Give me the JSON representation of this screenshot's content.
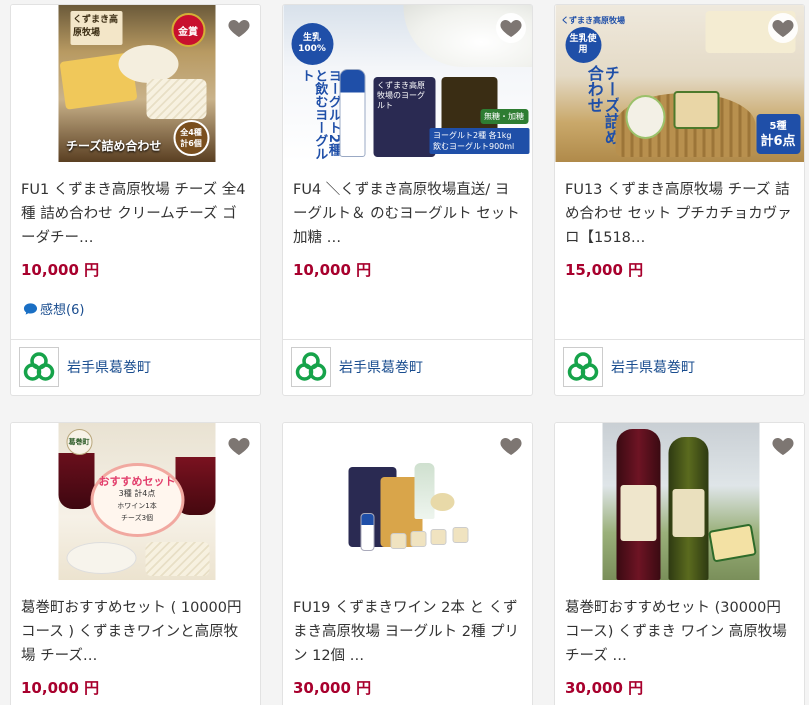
{
  "items": [
    {
      "title": "FU1 くずまき高原牧場 チーズ 全4種 詰め合わせ クリームチーズ ゴーダチー…",
      "price": "10,000 円",
      "review": "感想(6)",
      "municipality": "岩手県葛巻町",
      "img": {
        "brand": "くずまき高原牧場",
        "award": "金賞",
        "caption": "チーズ詰め合わせ",
        "badge_main": "全4種",
        "badge_sub": "計6個"
      }
    },
    {
      "title": "FU4 ＼くずまき高原牧場直送/ ヨーグルト＆ のむヨーグルト セット 加糖 …",
      "price": "10,000 円",
      "municipality": "岩手県葛巻町",
      "img": {
        "badge": "生乳100%",
        "vertical": "ヨーグルト2種と飲むヨーグルト",
        "pack1": "くずまき高原牧場のヨーグルト",
        "pack_tag": "無糖・加糖",
        "band1": "ヨーグルト2種",
        "band_kg": "各1kg",
        "band2": "飲むヨーグルト900ml"
      }
    },
    {
      "title": "FU13 くずまき高原牧場 チーズ 詰め合わせ セット プチカチョカヴァロ【1518…",
      "price": "15,000 円",
      "municipality": "岩手県葛巻町",
      "img": {
        "top": "くずまき高原牧場",
        "badge": "生乳使用",
        "vertical": "チーズ詰め合わせ",
        "count_top": "5種",
        "count_bottom": "計6点"
      }
    },
    {
      "title": "葛巻町おすすめセット ( 10000円コース ) くずまきワインと高原牧場 チーズ…",
      "price": "10,000 円",
      "img": {
        "tag": "葛巻町",
        "headline": "おすすめセット",
        "line1": "3種 計4点",
        "line2": "ホワイン1本",
        "line3": "チーズ3個"
      }
    },
    {
      "title": "FU19 くずまきワイン 2本 と くずまき高原牧場 ヨーグルト 2種 プリン 12個 …",
      "price": "30,000 円"
    },
    {
      "title": "葛巻町おすすめセット (30000円コース) くずまき ワイン 高原牧場 チーズ …",
      "price": "30,000 円"
    }
  ],
  "colors": {
    "price": "#a8002d",
    "link": "#1a4d8f",
    "heart": "#7d7672",
    "logo_green": "#16a34a"
  }
}
